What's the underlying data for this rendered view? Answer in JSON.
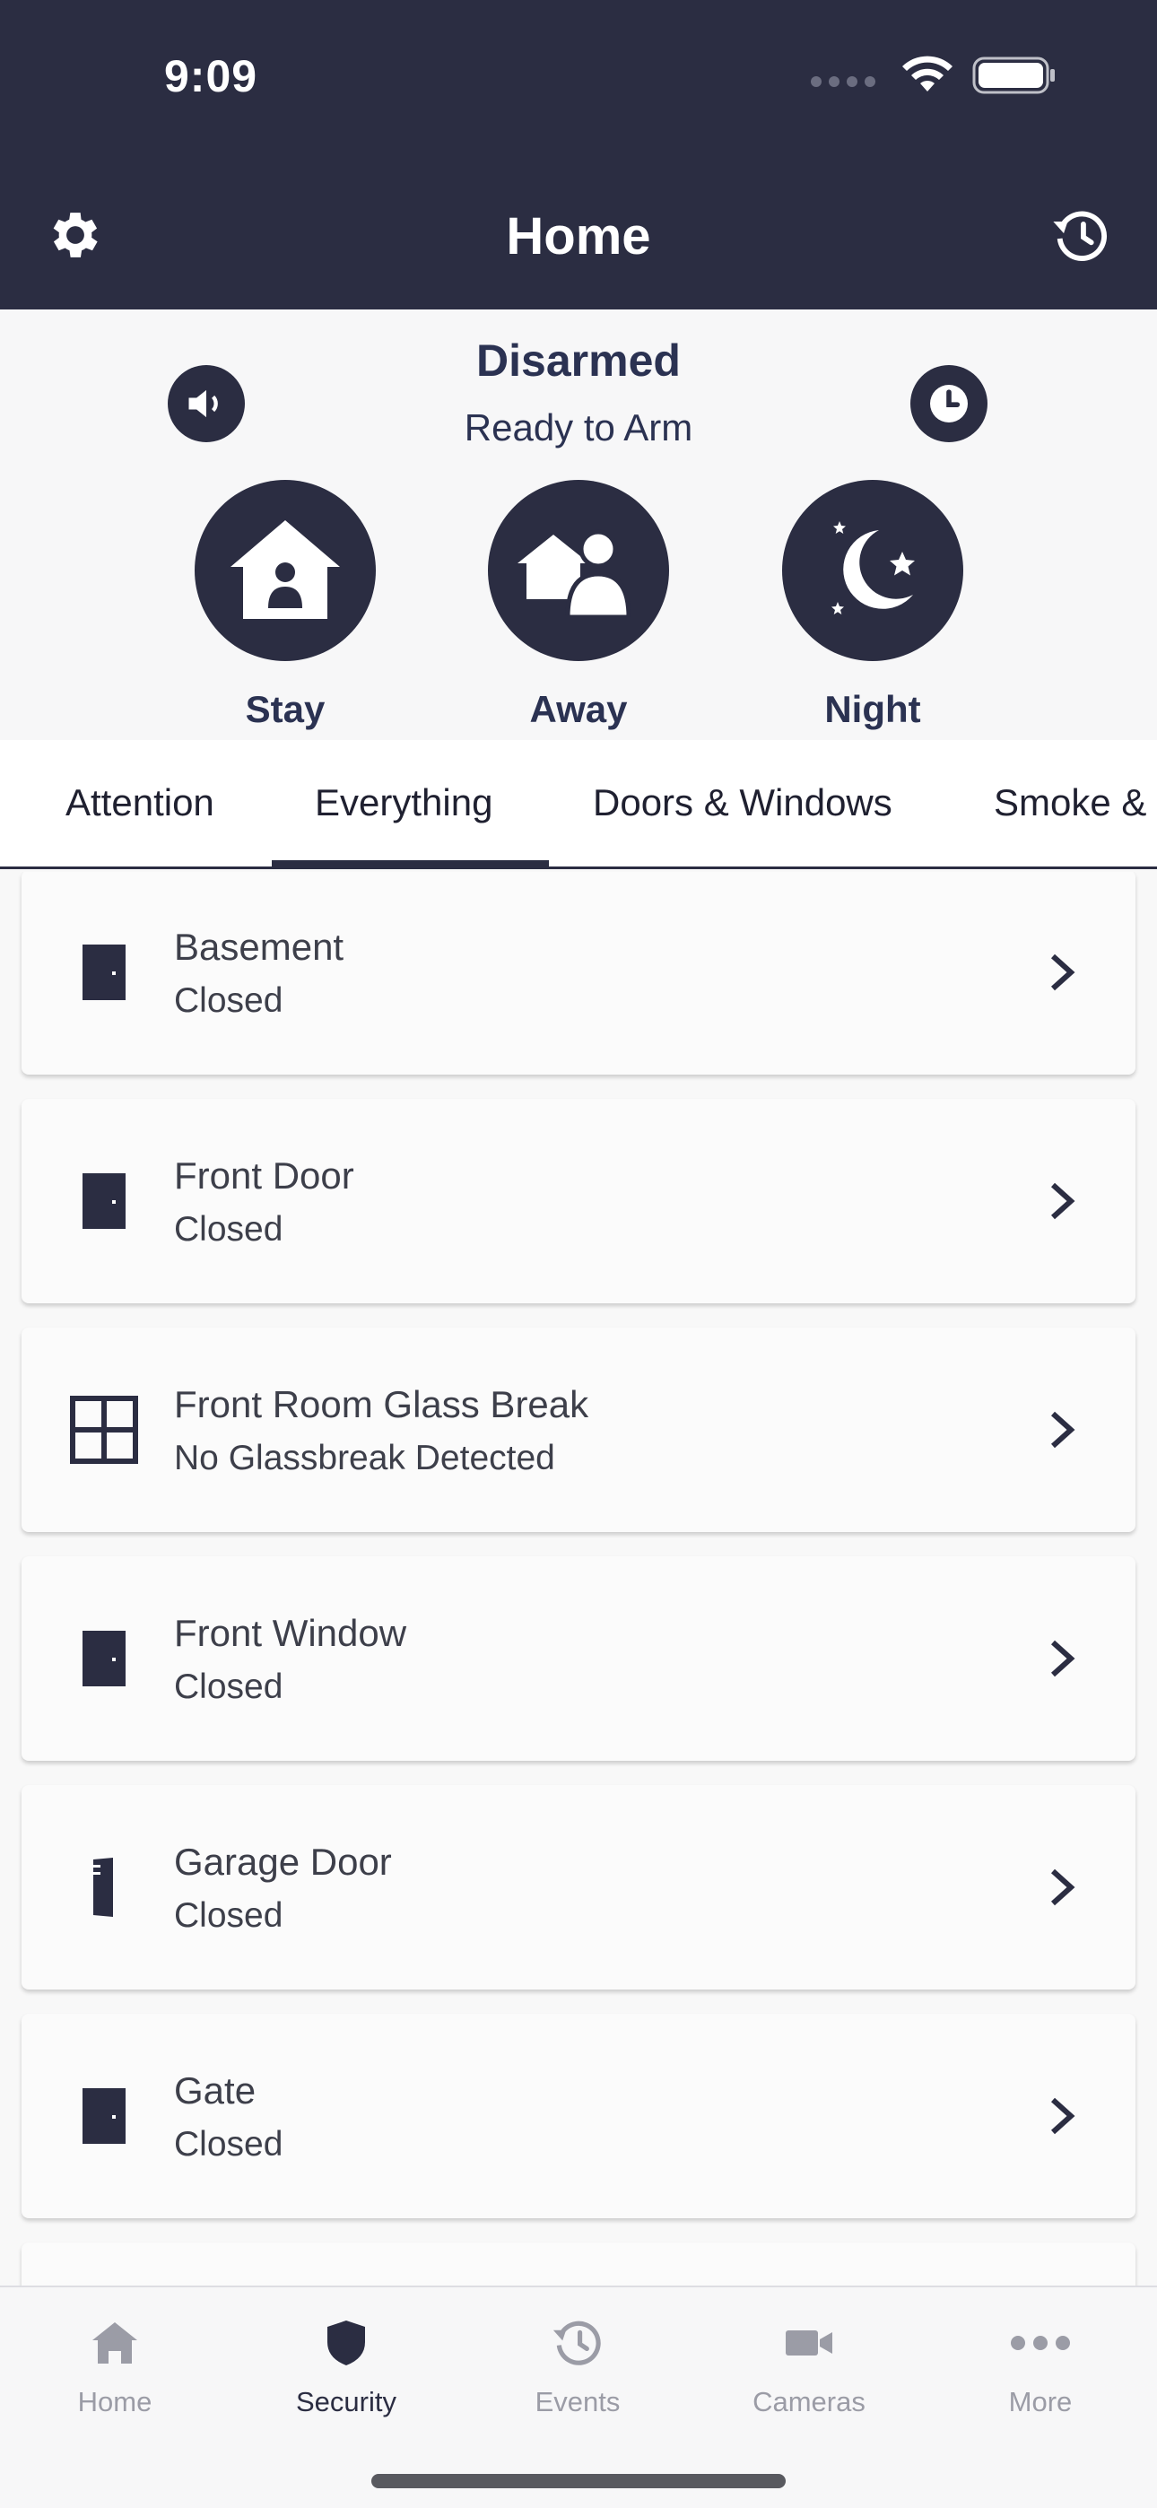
{
  "status_bar": {
    "time": "9:09"
  },
  "nav": {
    "title": "Home"
  },
  "arming": {
    "status": "Disarmed",
    "substatus": "Ready to Arm",
    "modes": [
      {
        "label": "Stay",
        "icon": "house-person-icon"
      },
      {
        "label": "Away",
        "icon": "person-leaving-house-icon"
      },
      {
        "label": "Night",
        "icon": "moon-stars-icon"
      }
    ]
  },
  "tabs": [
    {
      "label": "Attention",
      "selected": false
    },
    {
      "label": "Everything",
      "selected": true
    },
    {
      "label": "Doors & Windows",
      "selected": false
    },
    {
      "label": "Smoke &",
      "selected": false
    }
  ],
  "devices": [
    {
      "name": "Basement",
      "state": "Closed",
      "icon": "door-icon"
    },
    {
      "name": "Front Door",
      "state": "Closed",
      "icon": "door-icon"
    },
    {
      "name": "Front Room Glass Break",
      "state": "No Glassbreak Detected",
      "icon": "window-icon"
    },
    {
      "name": "Front Window",
      "state": "Closed",
      "icon": "door-icon"
    },
    {
      "name": "Garage Door",
      "state": "Closed",
      "icon": "garage-door-icon"
    },
    {
      "name": "Gate",
      "state": "Closed",
      "icon": "door-icon"
    }
  ],
  "tabbar": [
    {
      "label": "Home",
      "icon": "home-icon",
      "active": false
    },
    {
      "label": "Security",
      "icon": "shield-icon",
      "active": true
    },
    {
      "label": "Events",
      "icon": "history-icon",
      "active": false
    },
    {
      "label": "Cameras",
      "icon": "camera-icon",
      "active": false
    },
    {
      "label": "More",
      "icon": "more-icon",
      "active": false
    }
  ],
  "colors": {
    "primary": "#2b2d42",
    "inactive": "#9b9ca6",
    "background": "#f8f8f8"
  }
}
